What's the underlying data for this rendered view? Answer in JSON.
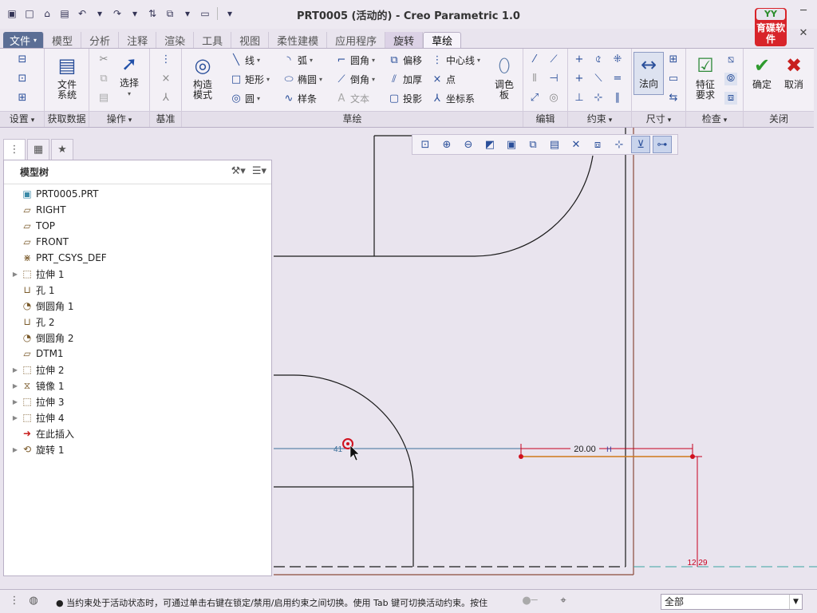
{
  "window": {
    "title": "PRT0005 (活动的) - Creo Parametric 1.0"
  },
  "logo": {
    "top": "YY",
    "bottom": "育碟软件"
  },
  "tabs": [
    "文件",
    "模型",
    "分析",
    "注释",
    "渲染",
    "工具",
    "视图",
    "柔性建模",
    "应用程序",
    "旋转",
    "草绘"
  ],
  "ribbon": {
    "file_system": "文件\n系统",
    "select": "选择",
    "construction_mode": "构造\n模式",
    "line": "线",
    "rectangle": "矩形",
    "circle": "圆",
    "arc": "弧",
    "ellipse": "椭圆",
    "spline": "样条",
    "fillet": "圆角",
    "chamfer": "倒角",
    "text": "文本",
    "offset": "偏移",
    "thicken": "加厚",
    "project": "投影",
    "centerline": "中心线",
    "point": "点",
    "coordinate_system": "坐标系",
    "palette": "调色\n板",
    "normal": "法向",
    "feature_requirements": "特征\n要求",
    "ok": "确定",
    "cancel": "取消",
    "groups": [
      "设置",
      "获取数据",
      "操作",
      "基准",
      "草绘",
      "编辑",
      "约束",
      "尺寸",
      "检查",
      "关闭"
    ]
  },
  "model_tree": {
    "title": "模型树",
    "items": [
      {
        "label": "PRT0005.PRT",
        "icon": "part-icon",
        "expand": false
      },
      {
        "label": "RIGHT",
        "icon": "datum-plane-icon",
        "expand": false
      },
      {
        "label": "TOP",
        "icon": "datum-plane-icon",
        "expand": false
      },
      {
        "label": "FRONT",
        "icon": "datum-plane-icon",
        "expand": false
      },
      {
        "label": "PRT_CSYS_DEF",
        "icon": "csys-icon",
        "expand": false
      },
      {
        "label": "拉伸 1",
        "icon": "extrude-icon",
        "expand": true
      },
      {
        "label": "孔 1",
        "icon": "hole-icon",
        "expand": false
      },
      {
        "label": "倒圆角 1",
        "icon": "round-icon",
        "expand": false
      },
      {
        "label": "孔 2",
        "icon": "hole-icon",
        "expand": false
      },
      {
        "label": "倒圆角 2",
        "icon": "round-icon",
        "expand": false
      },
      {
        "label": "DTM1",
        "icon": "datum-plane-icon",
        "expand": false
      },
      {
        "label": "拉伸 2",
        "icon": "extrude-icon",
        "expand": true
      },
      {
        "label": "镜像 1",
        "icon": "mirror-icon",
        "expand": true
      },
      {
        "label": "拉伸 3",
        "icon": "extrude-icon",
        "expand": true
      },
      {
        "label": "拉伸 4",
        "icon": "extrude-icon",
        "expand": true
      },
      {
        "label": "在此插入",
        "icon": "insert-here-icon",
        "expand": false
      },
      {
        "label": "旋转 1",
        "icon": "revolve-icon",
        "expand": true
      }
    ]
  },
  "sketch": {
    "dim_horizontal": "20.00",
    "dim_live": "41",
    "dim_vertical": "12.29"
  },
  "status": {
    "message": "● 当约束处于活动状态时，可通过单击右键在锁定/禁用/启用约束之间切换。使用 Tab 键可切换活动约束。按住",
    "filter": "全部"
  },
  "colors": {
    "accent": "#2a4f9a",
    "dimension": "#c8001e",
    "geometry": "#1a1a1a",
    "centerline": "#3aa3a3",
    "canvas": "#e9e4ee"
  }
}
